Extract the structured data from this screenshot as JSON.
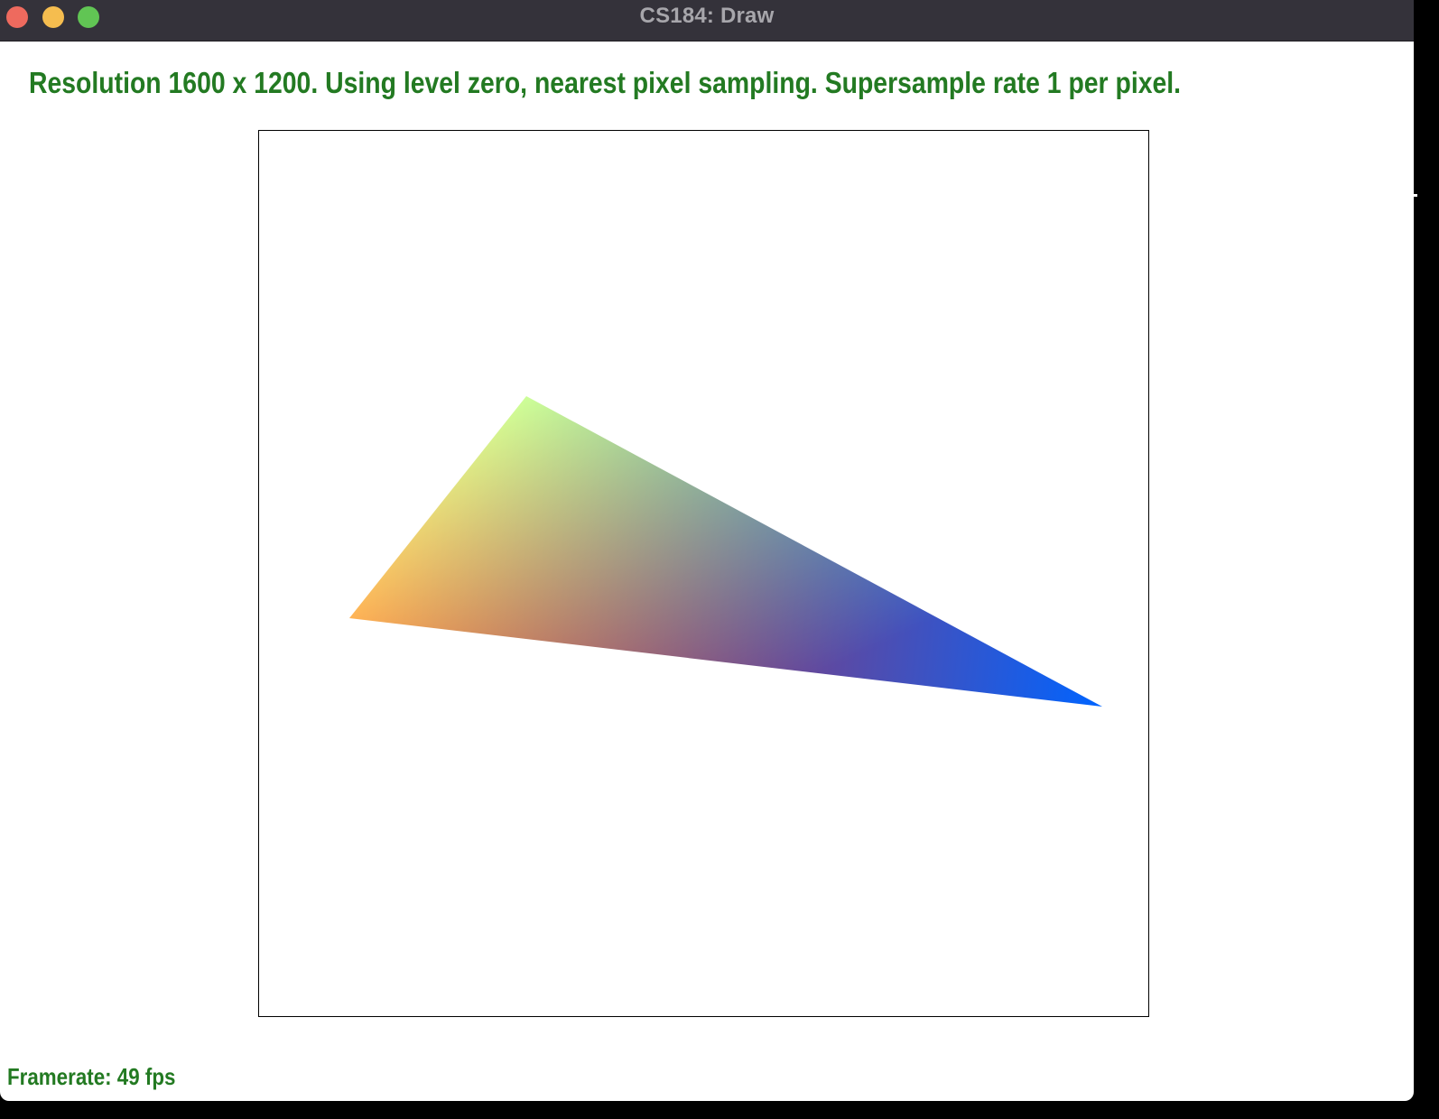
{
  "window": {
    "title": "CS184: Draw"
  },
  "status": {
    "message": "Resolution 1600 x 1200. Using level zero, nearest pixel sampling. Supersample rate 1 per pixel."
  },
  "footer": {
    "framerate": "Framerate: 49 fps"
  },
  "colors": {
    "status_text": "#237a22",
    "titlebar_bg": "#34323a",
    "vertex_red": "#ff1a00",
    "vertex_green": "#00ff7f",
    "vertex_blue": "#0064ff"
  },
  "icons": {
    "close": "close-icon",
    "minimize": "minimize-icon",
    "maximize": "maximize-icon"
  }
}
